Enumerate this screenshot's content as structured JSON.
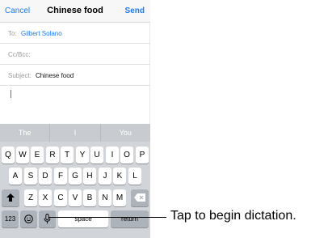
{
  "nav": {
    "cancel": "Cancel",
    "title": "Chinese food",
    "send": "Send"
  },
  "fields": {
    "to_label": "To:",
    "to_value": "Gilbert Solano",
    "cc_label": "Cc/Bcc:",
    "subject_label": "Subject:",
    "subject_value": "Chinese food"
  },
  "keyboard": {
    "suggestions": [
      "The",
      "I",
      "You"
    ],
    "row1": [
      "Q",
      "W",
      "E",
      "R",
      "T",
      "Y",
      "U",
      "I",
      "O",
      "P"
    ],
    "row2": [
      "A",
      "S",
      "D",
      "F",
      "G",
      "H",
      "J",
      "K",
      "L"
    ],
    "row3": [
      "Z",
      "X",
      "C",
      "V",
      "B",
      "N",
      "M"
    ],
    "numbers_label": "123",
    "space_label": "space",
    "return_label": "return"
  },
  "callout": "Tap to begin dictation.",
  "colors": {
    "accent": "#1a7cf5",
    "keyboard_bg": "#d1d4d8",
    "suggestion_bar": "#c8cbcf"
  }
}
